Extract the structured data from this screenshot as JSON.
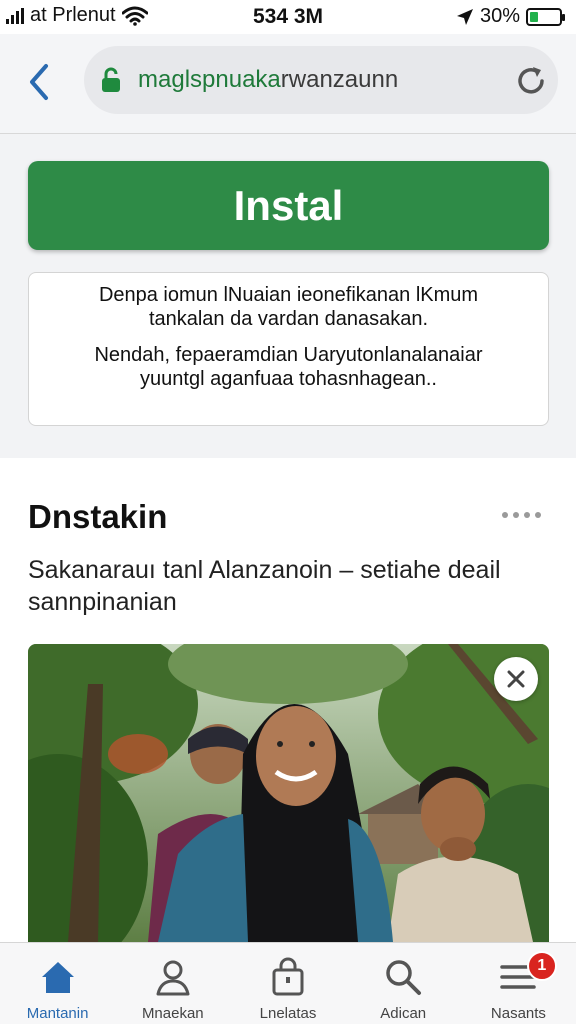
{
  "status_bar": {
    "carrier": "at Prlenut",
    "time": "534 3M",
    "battery_percent": "30%",
    "battery_level": 0.3,
    "icons": [
      "signal-icon",
      "wifi-icon",
      "location-arrow-icon",
      "battery-icon"
    ]
  },
  "url_bar": {
    "url_main": "maglspnuaka",
    "url_rest": "rwanzaunn",
    "icons": [
      "back-chevron-icon",
      "lock-icon",
      "reload-icon"
    ],
    "accent": "#1f7a3a"
  },
  "install": {
    "label": "Instal",
    "color": "#2e8b47"
  },
  "info_card": {
    "line1": "Denpa iomun lNuaian ieonefikanan lKmum",
    "line2": "tankalan da vardan danasakan.",
    "line3": "Nendah, fepaeramdian Uaryutonlanalanaiar",
    "line4": "yuuntgl aganfuaa tohasnhagean.."
  },
  "article": {
    "title": "Dnstakin",
    "description": "Sakanarauı tanl Alanzanoin – setiahe deail sannpinanian",
    "icons": [
      "more-dots-icon",
      "close-icon"
    ]
  },
  "bottom_nav": {
    "items": [
      {
        "label": "Mantanin",
        "icon": "home-icon",
        "active": true
      },
      {
        "label": "Mnaekan",
        "icon": "person-icon",
        "active": false
      },
      {
        "label": "Lnelatas",
        "icon": "shopping-bag-icon",
        "active": false
      },
      {
        "label": "Adican",
        "icon": "search-icon",
        "active": false
      },
      {
        "label": "Nasants",
        "icon": "menu-icon",
        "active": false,
        "badge": "1"
      }
    ],
    "active_color": "#2a6ab0",
    "badge_color": "#d9241f"
  }
}
